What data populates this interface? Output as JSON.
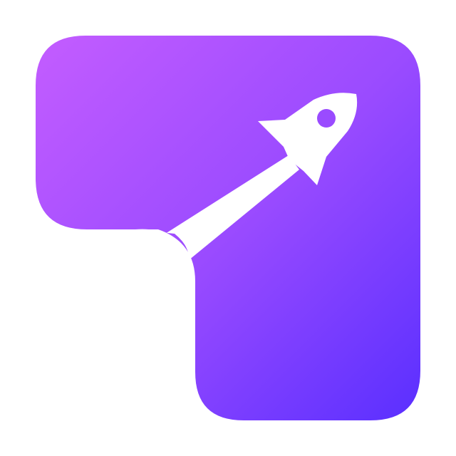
{
  "logo": {
    "icon": "rocket-logo-icon",
    "colors": {
      "gradient_start": "#c25cff",
      "gradient_mid": "#9a4bff",
      "gradient_end": "#5a2fff",
      "glyph": "#ffffff",
      "background": "#ffffff"
    }
  }
}
